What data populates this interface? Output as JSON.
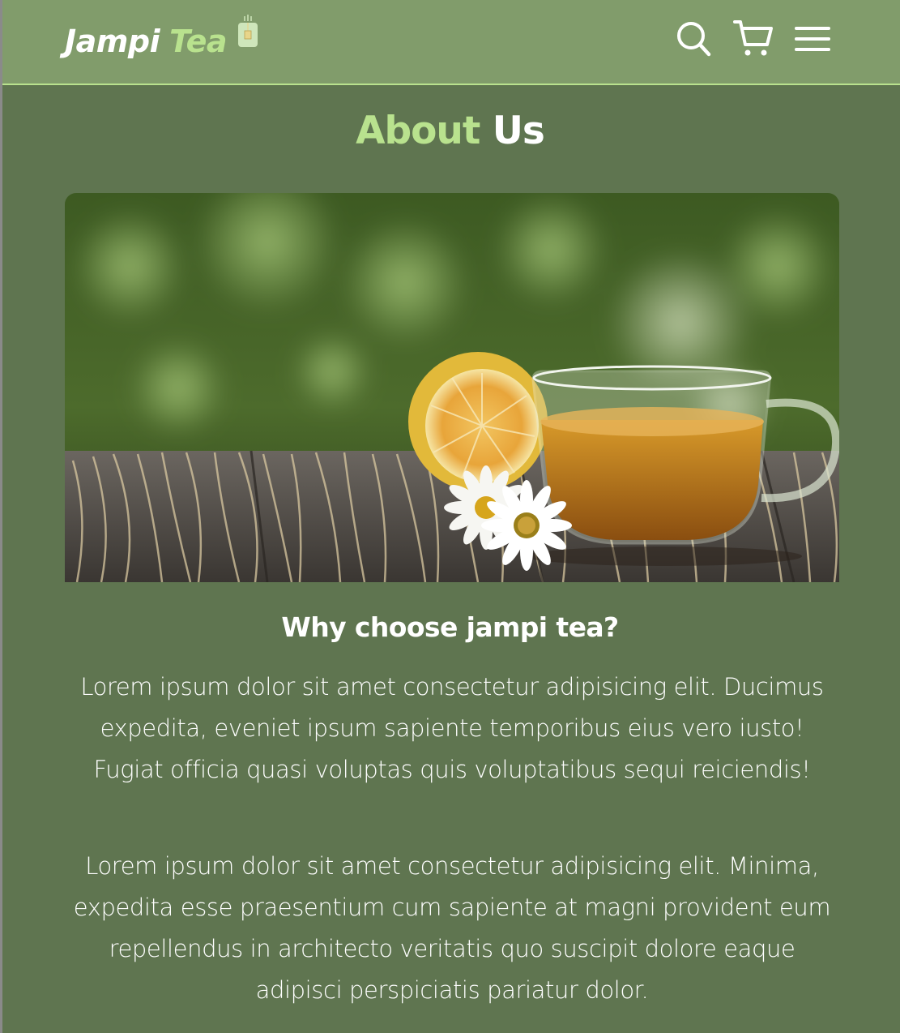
{
  "header": {
    "logo_word1": "Jampi",
    "logo_word2": "Tea",
    "icons": [
      "tea-cup-icon",
      "search-icon",
      "cart-icon",
      "hamburger-menu-icon"
    ]
  },
  "about": {
    "title_highlight": "About",
    "title_rest": "Us",
    "hero_image_alt": "Cup of tea with lemon and chamomile flowers on a wooden table",
    "subtitle": "Why choose jampi tea?",
    "paragraphs": [
      "Lorem ipsum dolor sit amet consectetur adipisicing elit. Ducimus expedita, eveniet ipsum sapiente temporibus eius vero iusto! Fugiat officia quasi voluptas quis voluptatibus sequi reiciendis!",
      "Lorem ipsum dolor sit amet consectetur adipisicing elit. Minima, expedita esse praesentium cum sapiente at magni provident eum repellendus in architecto veritatis quo suscipit dolore eaque adipisci perspiciatis pariatur dolor."
    ]
  },
  "colors": {
    "header_bg": "#819c6b",
    "page_bg": "#5f7550",
    "accent": "#b9e28e",
    "text": "#ffffff"
  }
}
